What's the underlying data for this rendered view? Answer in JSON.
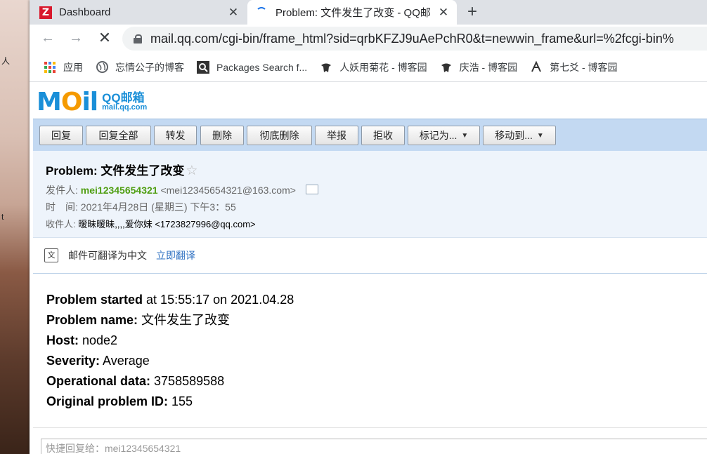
{
  "desktop": {
    "fragments": [
      "人",
      "t"
    ]
  },
  "tabs": [
    {
      "title": "Dashboard",
      "favicon": "Z",
      "close": "✕"
    },
    {
      "title": "Problem: 文件发生了改变 - QQ邮",
      "close": "✕"
    }
  ],
  "new_tab": "+",
  "nav": {
    "back": "←",
    "forward": "→",
    "stop": "✕"
  },
  "address": "mail.qq.com/cgi-bin/frame_html?sid=qrbKFZJ9uAePchR0&t=newwin_frame&url=%2fcgi-bin%",
  "bookmarks": [
    {
      "label": "应用",
      "icon": "apps-grid-icon"
    },
    {
      "label": "忘情公子的博客",
      "icon": "globe-icon"
    },
    {
      "label": "Packages Search f...",
      "icon": "magnifier-icon"
    },
    {
      "label": "人妖用菊花 - 博客园",
      "icon": "cnblogs-icon"
    },
    {
      "label": "庆浩 - 博客园",
      "icon": "cnblogs-icon"
    },
    {
      "label": "第七爻 - 博客园",
      "icon": "cnblogs-icon"
    }
  ],
  "logo": {
    "mark_m": "M",
    "mark_o": "O",
    "mark_il": "il",
    "name": "QQ邮箱",
    "domain": "mail.qq.com"
  },
  "actions": {
    "reply": "回复",
    "reply_all": "回复全部",
    "forward": "转发",
    "delete": "删除",
    "delete_permanent": "彻底删除",
    "report": "举报",
    "reject": "拒收",
    "mark_as": "标记为...",
    "move_to": "移动到..."
  },
  "message": {
    "subject": "Problem: 文件发生了改变",
    "from_label": "发件人:",
    "from_name": "mei12345654321",
    "from_email": "<mei12345654321@163.com>",
    "time_label": "时　间:",
    "time_value": "2021年4月28日 (星期三) 下午3：55",
    "to_label": "收件人:",
    "to_name": "暧昧暧昧,,,,爱你妹",
    "to_email": "<1723827996@qq.com>"
  },
  "translate": {
    "text": "邮件可翻译为中文",
    "link": "立即翻译"
  },
  "body": [
    {
      "key": "Problem started",
      "value": " at 15:55:17 on 2021.04.28"
    },
    {
      "key": "Problem name:",
      "value": " 文件发生了改变"
    },
    {
      "key": "Host:",
      "value": " node2"
    },
    {
      "key": "Severity:",
      "value": " Average"
    },
    {
      "key": "Operational data:",
      "value": " 3758589588"
    },
    {
      "key": "Original problem ID:",
      "value": " 155"
    }
  ],
  "quick_reply_placeholder": "快捷回复给：mei12345654321",
  "colors": {
    "accent_green": "#4f9e12",
    "toolbar_blue": "#c3d9f2",
    "link_blue": "#3273c3",
    "favicon_red": "#d8182c"
  }
}
